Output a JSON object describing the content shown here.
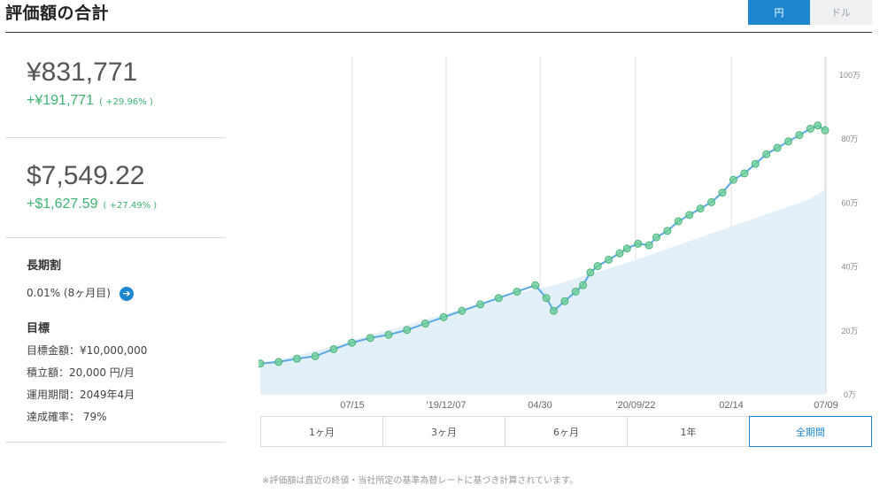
{
  "header": {
    "title": "評価額の合計"
  },
  "currency_toggle": {
    "yen": "円",
    "dollar": "ドル",
    "selected": "円"
  },
  "summary": {
    "yen": {
      "amount": "¥831,771",
      "gain": "+¥191,771",
      "gain_pct": "( +29.96% )"
    },
    "usd": {
      "amount": "$7,549.22",
      "gain": "+$1,627.59",
      "gain_pct": "( +27.49% )"
    }
  },
  "long_term": {
    "title": "長期割",
    "value": "0.01% (8ヶ月目)"
  },
  "goal": {
    "title": "目標",
    "amount": "目標金額：¥10,000,000",
    "monthly": "積立額：20,000 円/月",
    "period": "運用期間：2049年4月",
    "probability": "達成確率： 79%"
  },
  "range_tabs": [
    "1ヶ月",
    "3ヶ月",
    "6ヶ月",
    "1年",
    "全期間"
  ],
  "range_selected": "全期間",
  "footnote": "※評価額は直近の終値・当社所定の基準為替レートに基づき計算されています。",
  "chart_data": {
    "type": "area",
    "x_tick_labels": [
      "07/15",
      "'19/12/07",
      "04/30",
      "'20/09/22",
      "02/14",
      "07/09"
    ],
    "y_tick_labels": [
      "0万",
      "20万",
      "40万",
      "60万",
      "80万",
      "100万"
    ],
    "ylim": [
      0,
      1000000
    ],
    "grid": "vertical",
    "series": [
      {
        "style": "line",
        "color": "#5aa9e6",
        "points": [
          [
            0,
            95000
          ],
          [
            5,
            100000
          ],
          [
            10,
            110000
          ],
          [
            15,
            118000
          ],
          [
            20,
            140000
          ],
          [
            25,
            160000
          ],
          [
            30,
            175000
          ],
          [
            35,
            185000
          ],
          [
            40,
            200000
          ],
          [
            45,
            220000
          ],
          [
            50,
            240000
          ],
          [
            55,
            260000
          ],
          [
            60,
            280000
          ],
          [
            65,
            300000
          ],
          [
            70,
            320000
          ],
          [
            75,
            340000
          ],
          [
            78,
            300000
          ],
          [
            80,
            260000
          ],
          [
            83,
            290000
          ],
          [
            86,
            320000
          ],
          [
            88,
            340000
          ],
          [
            90,
            380000
          ],
          [
            92,
            400000
          ],
          [
            95,
            420000
          ],
          [
            98,
            440000
          ],
          [
            100,
            455000
          ],
          [
            103,
            470000
          ],
          [
            106,
            465000
          ],
          [
            108,
            490000
          ],
          [
            111,
            510000
          ],
          [
            114,
            540000
          ],
          [
            117,
            560000
          ],
          [
            120,
            580000
          ],
          [
            123,
            600000
          ],
          [
            126,
            630000
          ],
          [
            129,
            670000
          ],
          [
            132,
            690000
          ],
          [
            135,
            720000
          ],
          [
            138,
            750000
          ],
          [
            141,
            770000
          ],
          [
            144,
            790000
          ],
          [
            147,
            810000
          ],
          [
            150,
            830000
          ],
          [
            152,
            840000
          ],
          [
            154,
            825000
          ]
        ]
      },
      {
        "style": "area",
        "color": "#e3f0f9",
        "points": [
          [
            0,
            95000
          ],
          [
            10,
            120000
          ],
          [
            20,
            150000
          ],
          [
            30,
            185000
          ],
          [
            40,
            215000
          ],
          [
            50,
            250000
          ],
          [
            60,
            280000
          ],
          [
            70,
            315000
          ],
          [
            80,
            340000
          ],
          [
            90,
            375000
          ],
          [
            100,
            410000
          ],
          [
            110,
            450000
          ],
          [
            120,
            490000
          ],
          [
            130,
            530000
          ],
          [
            140,
            570000
          ],
          [
            150,
            610000
          ],
          [
            154,
            640000
          ]
        ]
      }
    ]
  }
}
